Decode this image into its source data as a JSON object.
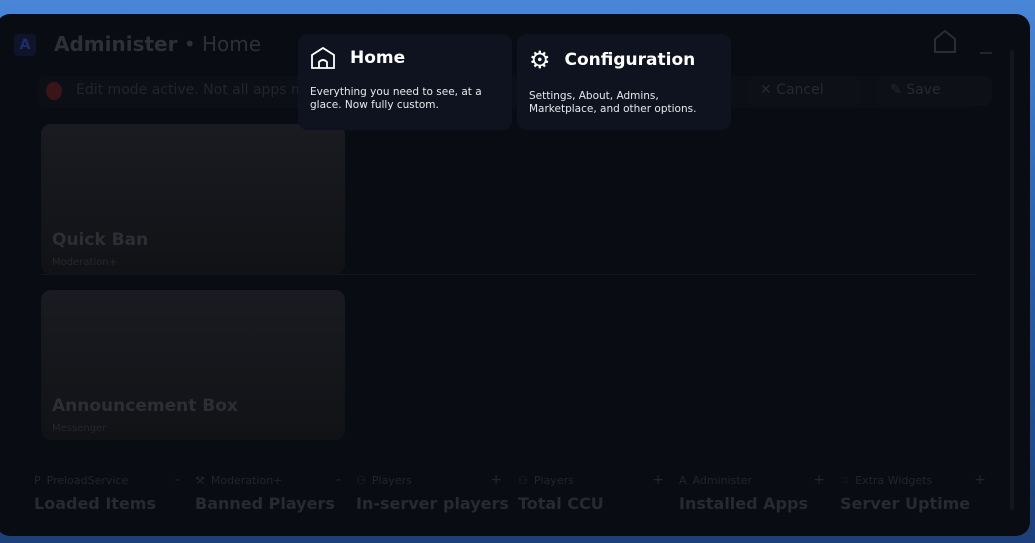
{
  "header": {
    "logo": "A",
    "app": "Administer",
    "sep": " • ",
    "page": "Home"
  },
  "edit_bar": {
    "message": "Edit mode active. Not all apps may",
    "cancel": "Cancel",
    "save": "Save"
  },
  "cards": [
    {
      "name": "Quick Ban",
      "sub": "Moderation+"
    },
    {
      "name": "Announcement Box",
      "sub": "Messenger"
    }
  ],
  "stats": [
    {
      "source": "PreloadService",
      "action": "-",
      "label": "Loaded Items"
    },
    {
      "source": "Moderation+",
      "action": "-",
      "label": "Banned Players"
    },
    {
      "source": "Players",
      "action": "+",
      "label": "In-server players"
    },
    {
      "source": "Players",
      "action": "+",
      "label": "Total CCU"
    },
    {
      "source": "Administer",
      "action": "+",
      "label": "Installed Apps"
    },
    {
      "source": "Extra Widgets",
      "action": "+",
      "label": "Server Uptime"
    }
  ],
  "menu": [
    {
      "title": "Home",
      "desc": "Everything you need to see, at a glace. Now fully custom."
    },
    {
      "title": "Configuration",
      "desc": "Settings, About, Admins, Marketplace, and other options."
    }
  ]
}
